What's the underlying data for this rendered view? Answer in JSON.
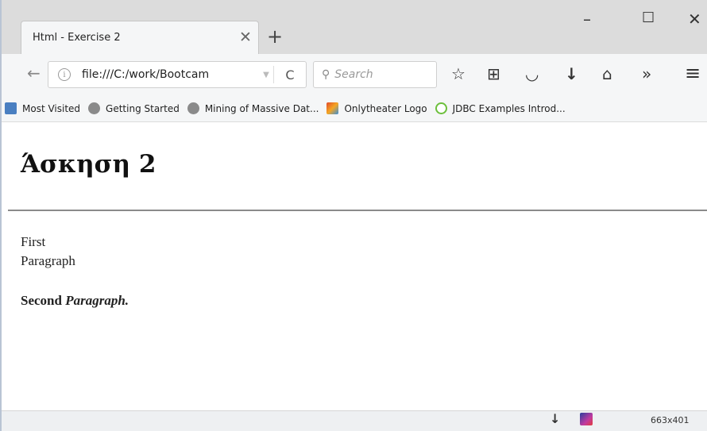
{
  "tab": {
    "title": "Html - Exercise 2",
    "close_glyph": "✕",
    "new_tab_glyph": "+"
  },
  "window_controls": {
    "minimize": "–",
    "maximize": "☐",
    "close": "✕"
  },
  "toolbar": {
    "back_glyph": "←",
    "url": "file:///C:/work/Bootcam",
    "url_dropdown_glyph": "▼",
    "reload_glyph": "C",
    "search_placeholder": "Search",
    "search_glyph": "⚲",
    "bookmark_star_glyph": "☆",
    "reader_glyph": "⊞",
    "pocket_glyph": "◡",
    "download_glyph": "↓",
    "home_glyph": "⌂",
    "overflow_glyph": "»",
    "menu_glyph": "≡"
  },
  "bookmarks": [
    {
      "label": "Most Visited",
      "icon": "document-icon"
    },
    {
      "label": "Getting Started",
      "icon": "globe-icon"
    },
    {
      "label": "Mining of Massive Dat...",
      "icon": "globe-icon"
    },
    {
      "label": "Onlytheater Logo",
      "icon": "joomla-icon"
    },
    {
      "label": "JDBC Examples Introd...",
      "icon": "jdbc-icon"
    }
  ],
  "page": {
    "heading": "Άσκηση 2",
    "paragraph1_line1": "First",
    "paragraph1_line2": "Paragraph",
    "paragraph2_bold": "Second ",
    "paragraph2_italic": "Paragraph."
  },
  "statusbar": {
    "download_glyph": "↓",
    "dimensions": "663x401"
  },
  "colors": {
    "tab_strip": "#dcdcdc",
    "toolbar": "#f5f6f7",
    "statusbar": "#eef0f2"
  }
}
